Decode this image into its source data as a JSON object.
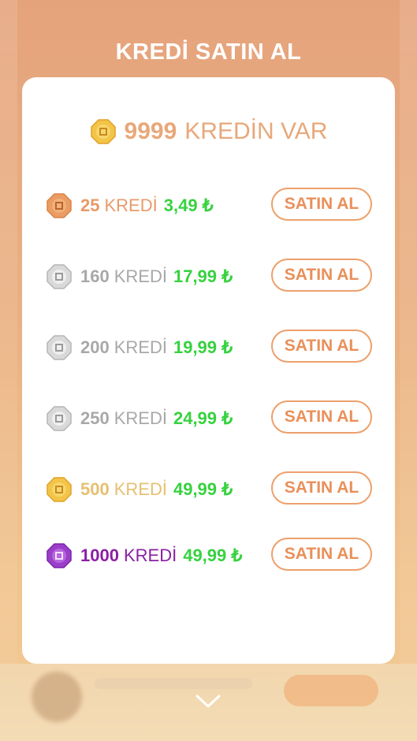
{
  "title": "KREDİ SATIN AL",
  "balance": {
    "amount": "9999",
    "label": "KREDİN VAR"
  },
  "packages": [
    {
      "qty": "25",
      "unit": "KREDİ",
      "price": "3,49 ₺",
      "buy_label": "SATIN AL",
      "tier": "bronze",
      "qty_color": "#e89a6a"
    },
    {
      "qty": "160",
      "unit": "KREDİ",
      "price": "17,99 ₺",
      "buy_label": "SATIN AL",
      "tier": "silver",
      "qty_color": "#a8a8a8"
    },
    {
      "qty": "200",
      "unit": "KREDİ",
      "price": "19,99 ₺",
      "buy_label": "SATIN AL",
      "tier": "silver",
      "qty_color": "#a8a8a8"
    },
    {
      "qty": "250",
      "unit": "KREDİ",
      "price": "24,99 ₺",
      "buy_label": "SATIN AL",
      "tier": "silver",
      "qty_color": "#a8a8a8"
    },
    {
      "qty": "500",
      "unit": "KREDİ",
      "price": "49,99 ₺",
      "buy_label": "SATIN AL",
      "tier": "gold",
      "qty_color": "#e6c070"
    },
    {
      "qty": "1000",
      "unit": "KREDİ",
      "price": "49,99 ₺",
      "buy_label": "SATIN AL",
      "tier": "purple",
      "qty_color": "#8b1fa3"
    }
  ],
  "colors": {
    "price": "#36d23f",
    "button_border": "#eca06b",
    "button_text": "#e9905a"
  },
  "icons": {
    "coin": "coin-icon",
    "close": "chevron-down-icon"
  }
}
